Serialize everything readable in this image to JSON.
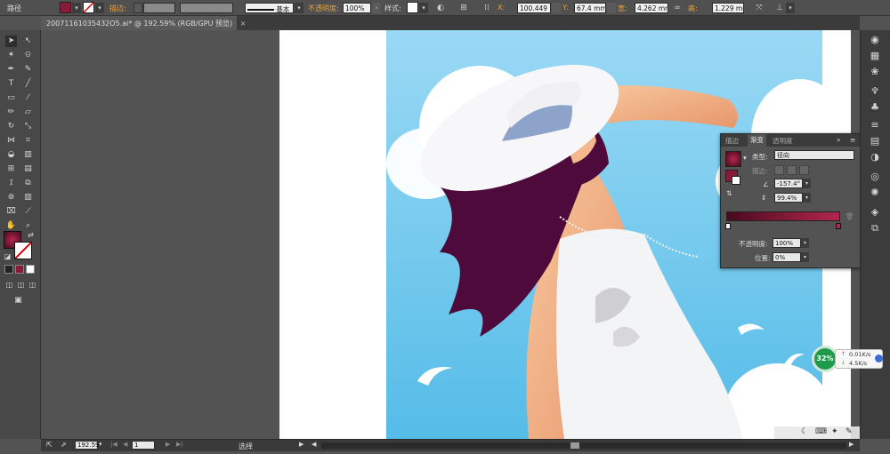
{
  "control_bar": {
    "path_label": "路径",
    "stroke_label": "描边:",
    "stroke_profile": "基本",
    "opacity_label": "不透明度:",
    "opacity_value": "100%",
    "style_label": "样式:",
    "x_label": "X:",
    "x_value": "100.449",
    "y_label": "Y:",
    "y_value": "67.4 mm",
    "width_label": "宽:",
    "width_value": "4.262 mm",
    "height_label": "高:",
    "height_value": "1.229 mm"
  },
  "document_tab": {
    "title": "20071161035432O5.ai* @ 192.59% (RGB/GPU 预览)"
  },
  "gradient_panel": {
    "tabs": [
      "描边",
      "渐变",
      "透明度"
    ],
    "type_label": "类型:",
    "type_value": "径向",
    "stroke_label": "描边:",
    "angle_value": "-157.4°",
    "aspect_value": "99.4%",
    "opacity_label": "不透明度:",
    "opacity_value": "100%",
    "location_label": "位置:",
    "location_value": "0%",
    "ramp_start_color": "#4a0a1e",
    "ramp_end_color": "#b3264f"
  },
  "status_bar": {
    "zoom_value": "192.59",
    "page_value": "1",
    "tool_name": "选择"
  },
  "net_widget": {
    "percent": "32%",
    "upload": "0.01K/s",
    "download": "4.5K/s"
  },
  "colors": {
    "fill_swatch": "#8a1a3a",
    "sky_top": "#8fd6f3",
    "sky_bottom": "#5bbfe8",
    "hair": "#4d0a3a",
    "skin": "#f4b88c"
  }
}
